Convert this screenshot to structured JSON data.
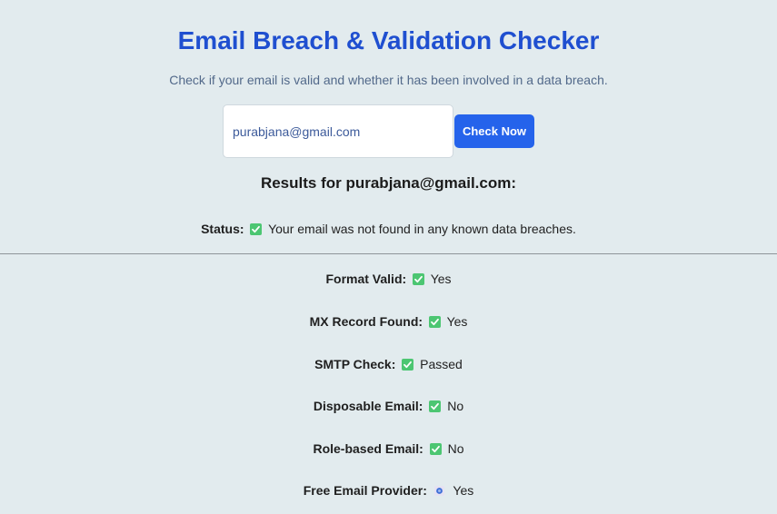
{
  "header": {
    "title": "Email Breach & Validation Checker",
    "subtitle": "Check if your email is valid and whether it has been involved in a data breach."
  },
  "form": {
    "email_value": "purabjana@gmail.com",
    "button_label": "Check Now"
  },
  "results": {
    "heading": "Results for purabjana@gmail.com:",
    "status": {
      "label": "Status:",
      "icon": "check-mark-icon",
      "value": "Your email was not found in any known data breaches."
    },
    "checks": [
      {
        "label": "Format Valid:",
        "icon": "check-mark-icon",
        "value": "Yes"
      },
      {
        "label": "MX Record Found:",
        "icon": "check-mark-icon",
        "value": "Yes"
      },
      {
        "label": "SMTP Check:",
        "icon": "check-mark-icon",
        "value": "Passed"
      },
      {
        "label": "Disposable Email:",
        "icon": "check-mark-icon",
        "value": "No"
      },
      {
        "label": "Role-based Email:",
        "icon": "check-mark-icon",
        "value": "No"
      },
      {
        "label": "Free Email Provider:",
        "icon": "info-dot-icon",
        "value": "Yes"
      }
    ]
  },
  "colors": {
    "background": "#e2ebee",
    "title": "#1f4fd0",
    "button": "#2563eb",
    "check": "#4cc672"
  }
}
